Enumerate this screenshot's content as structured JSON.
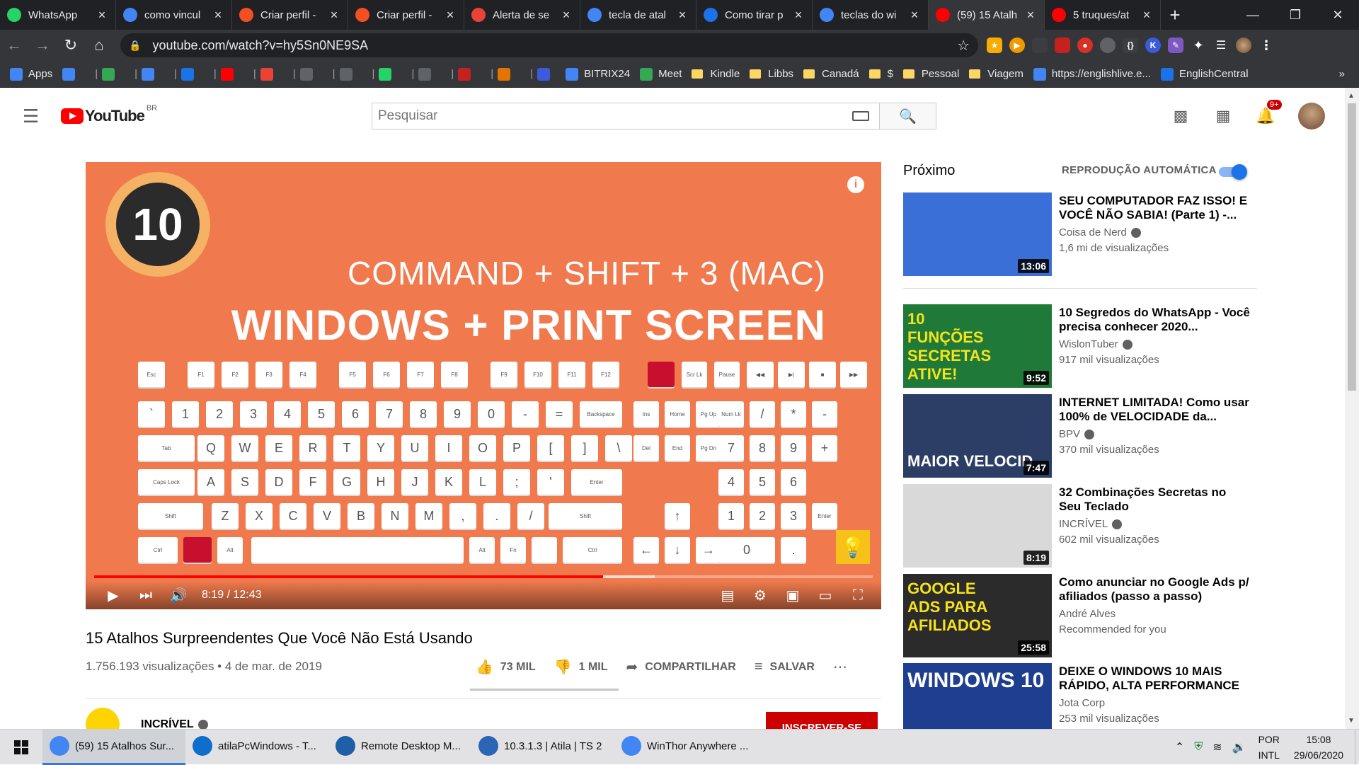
{
  "browser": {
    "tabs": [
      {
        "title": "WhatsApp",
        "icon": "whatsapp-icon",
        "color": "#25d366"
      },
      {
        "title": "como vincul",
        "icon": "google-icon",
        "color": "#4285f4"
      },
      {
        "title": "Criar perfil -",
        "icon": "microsoft-icon",
        "color": "#f25022"
      },
      {
        "title": "Criar perfil -",
        "icon": "microsoft-icon",
        "color": "#f25022"
      },
      {
        "title": "Alerta de se",
        "icon": "gmail-icon",
        "color": "#ea4335"
      },
      {
        "title": "tecla de atal",
        "icon": "google-icon",
        "color": "#4285f4"
      },
      {
        "title": "Como tirar p",
        "icon": "tb-icon",
        "color": "#1a73e8"
      },
      {
        "title": "teclas do wi",
        "icon": "google-icon",
        "color": "#4285f4"
      },
      {
        "title": "(59) 15 Atalh",
        "icon": "youtube-icon",
        "color": "#ff0000"
      },
      {
        "title": "5 truques/at",
        "icon": "youtube-icon",
        "color": "#ff0000"
      }
    ],
    "active_tab_index": 8,
    "url": "youtube.com/watch?v=hy5Sn0NE9SA",
    "bookmarks": [
      {
        "label": "Apps",
        "type": "apps"
      },
      {
        "label": "",
        "type": "site"
      },
      {
        "label": "",
        "type": "site"
      },
      {
        "label": "",
        "type": "site"
      },
      {
        "label": "",
        "type": "site"
      },
      {
        "label": "",
        "type": "site"
      },
      {
        "label": "",
        "type": "site"
      },
      {
        "label": "",
        "type": "site"
      },
      {
        "label": "",
        "type": "site"
      },
      {
        "label": "",
        "type": "site"
      },
      {
        "label": "",
        "type": "site"
      },
      {
        "label": "",
        "type": "site"
      },
      {
        "label": "",
        "type": "site"
      },
      {
        "label": "",
        "type": "site"
      },
      {
        "label": "BITRIX24",
        "type": "site"
      },
      {
        "label": "Meet",
        "type": "site"
      },
      {
        "label": "Kindle",
        "type": "folder"
      },
      {
        "label": "Libbs",
        "type": "folder"
      },
      {
        "label": "Canadá",
        "type": "folder"
      },
      {
        "label": "$",
        "type": "folder"
      },
      {
        "label": "Pessoal",
        "type": "folder"
      },
      {
        "label": "Viagem",
        "type": "folder"
      },
      {
        "label": "https://englishlive.e...",
        "type": "site"
      },
      {
        "label": "EnglishCentral",
        "type": "site"
      }
    ],
    "bookmarks_more": "»"
  },
  "youtube": {
    "logo_text": "YouTube",
    "country": "BR",
    "search_placeholder": "Pesquisar",
    "notification_count": "9+",
    "player": {
      "line1": "COMMAND + SHIFT + 3 (MAC)",
      "line2": "WINDOWS + PRINT SCREEN",
      "badge": "10",
      "info": "i",
      "time": "8:19 / 12:43",
      "played_fraction": 0.654,
      "buffered_fraction": 0.72
    },
    "video": {
      "title": "15 Atalhos Surpreendentes Que Você Não Está Usando",
      "meta": "1.756.193 visualizações • 4 de mar. de 2019",
      "likes": "73 MIL",
      "dislikes": "1 MIL",
      "share": "COMPARTILHAR",
      "save": "SALVAR",
      "channel": "INCRÍVEL",
      "subscribe": "INSCREVER-SE"
    },
    "sidebar": {
      "next_label": "Próximo",
      "autoplay_label": "REPRODUÇÃO AUTOMÁTICA",
      "autoplay_on": true,
      "items": [
        {
          "title": "SEU COMPUTADOR FAZ ISSO! E VOCÊ NÃO SABIA! (Parte 1) -...",
          "channel": "Coisa de Nerd",
          "verified": true,
          "views": "1,6 mi de visualizações",
          "duration": "13:06",
          "thumb_text": "",
          "thumb_color": "#3a6fd8"
        },
        {
          "title": "10 Segredos do WhatsApp - Você precisa conhecer 2020...",
          "channel": "WislonTuber",
          "verified": true,
          "views": "917 mil visualizações",
          "duration": "9:52",
          "thumb_text": "10 FUNÇÕES SECRETAS ATIVE!",
          "thumb_color": "#1f7a3a"
        },
        {
          "title": "INTERNET LIMITADA! Como usar 100% de VELOCIDADE da...",
          "channel": "BPV",
          "verified": true,
          "views": "370 mil visualizações",
          "duration": "7:47",
          "thumb_text": "MAIOR VELOCID",
          "thumb_color": "#2c3e66"
        },
        {
          "title": "32 Combinações Secretas no Seu Teclado",
          "channel": "INCRÍVEL",
          "verified": true,
          "views": "602 mil visualizações",
          "duration": "8:19",
          "thumb_text": "",
          "thumb_color": "#d9d9d9"
        },
        {
          "title": "Como anunciar no Google Ads p/ afiliados (passo a passo)",
          "channel": "André Alves",
          "verified": false,
          "views": "Recommended for you",
          "duration": "25:58",
          "thumb_text": "GOOGLE ADS PARA AFILIADOS",
          "thumb_color": "#2b2b2b"
        },
        {
          "title": "DEIXE O WINDOWS 10 MAIS RÁPIDO, ALTA PERFORMANCE",
          "channel": "Jota Corp",
          "verified": false,
          "views": "253 mil visualizações",
          "duration": "",
          "thumb_text": "WINDOWS 10",
          "thumb_color": "#1e3f8f"
        }
      ]
    }
  },
  "taskbar": {
    "items": [
      {
        "label": "(59) 15 Atalhos Sur...",
        "icon": "chrome-icon",
        "color": "#4285f4",
        "active": true
      },
      {
        "label": "atilaPcWindows - T...",
        "icon": "teamviewer-icon",
        "color": "#0e6ecb",
        "active": false
      },
      {
        "label": "Remote Desktop M...",
        "icon": "remote-desktop-icon",
        "color": "#1f5fa8",
        "active": false
      },
      {
        "label": "10.3.1.3 | Atila | TS 2",
        "icon": "rdp-icon",
        "color": "#2a66b5",
        "active": false
      },
      {
        "label": "WinThor Anywhere ...",
        "icon": "chrome-icon",
        "color": "#4285f4",
        "active": false
      }
    ],
    "lang": "POR",
    "layout": "INTL",
    "time": "15:08",
    "date": "29/06/2020"
  }
}
